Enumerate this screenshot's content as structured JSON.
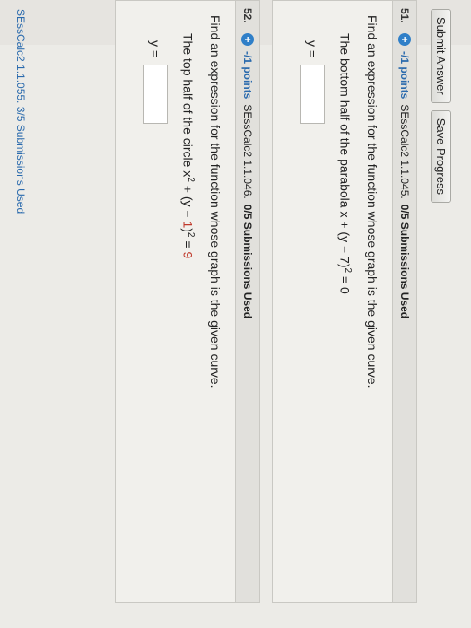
{
  "toolbar": {
    "submit_label": "Submit Answer",
    "save_label": "Save Progress"
  },
  "questions": [
    {
      "number": "51.",
      "points": "-/1 points",
      "source": "SEssCalc2 1.1.045.",
      "submissions": "0/5 Submissions Used",
      "prompt": "Find an expression for the function whose graph is the given curve.",
      "sub_prompt_text": "The bottom half of the parabola x + (y − 7)",
      "sub_prompt_exp": "2",
      "sub_prompt_tail": " = 0",
      "answer_label": "y ="
    },
    {
      "number": "52.",
      "points": "-/1 points",
      "source": "SEssCalc2 1.1.046.",
      "submissions": "0/5 Submissions Used",
      "prompt": "Find an expression for the function whose graph is the given curve.",
      "sub_prompt_text_a": "The top half of the circle x",
      "sub_prompt_exp_a": "2",
      "sub_prompt_text_b": " + (y − ",
      "sub_prompt_red_1": "1",
      "sub_prompt_text_c": ")",
      "sub_prompt_exp_b": "2",
      "sub_prompt_text_d": " = ",
      "sub_prompt_red_2": "9",
      "answer_label": "y ="
    }
  ],
  "bottom": {
    "text": "SEssCalc2 1.1.055. 3/5 Submissions Used"
  }
}
